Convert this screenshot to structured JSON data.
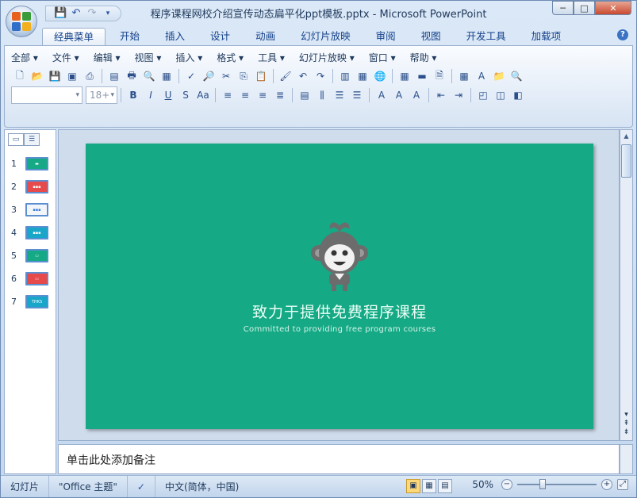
{
  "window": {
    "title": "程序课程网校介绍宣传动态扁平化ppt模板.pptx - Microsoft PowerPoint",
    "controls": {
      "minimize": "─",
      "maximize": "□",
      "close": "✕"
    }
  },
  "qat": {
    "save": "💾",
    "undo": "↶",
    "redo": "↷",
    "more": "▾"
  },
  "tabs": [
    "经典菜单",
    "开始",
    "插入",
    "设计",
    "动画",
    "幻灯片放映",
    "审阅",
    "视图",
    "开发工具",
    "加载项"
  ],
  "menu": [
    "全部 ▾",
    "文件 ▾",
    "编辑 ▾",
    "视图 ▾",
    "插入 ▾",
    "格式 ▾",
    "工具 ▾",
    "幻灯片放映 ▾",
    "窗口 ▾",
    "帮助 ▾"
  ],
  "font": {
    "name": "",
    "size": "18+"
  },
  "toolbar1": [
    "🗋",
    "📂",
    "💾",
    "▣",
    "⎙",
    "▤",
    "🖶",
    "🔍",
    "▦",
    "✓",
    "🔎",
    "✂",
    "⎘",
    "📋",
    "🖌",
    "↶",
    "↷",
    "▥",
    "▦",
    "🌐",
    "▦",
    "▬",
    "🗎",
    "▦",
    "A",
    "📁",
    "🔍"
  ],
  "toolbar2": [
    "B",
    "I",
    "U",
    "S",
    "Aa",
    "≡",
    "≡",
    "≡",
    "≣",
    "▤",
    "⫼",
    "☰",
    "☰",
    "A",
    "A",
    "A",
    "⇤",
    "⇥",
    "◰",
    "◫",
    "◧"
  ],
  "slides": [
    {
      "n": "1",
      "color": "#16a985",
      "label": "▬"
    },
    {
      "n": "2",
      "color": "#e64a4a",
      "label": "▪▪▪"
    },
    {
      "n": "3",
      "color": "#f2f6fb",
      "label": "▪▪▪"
    },
    {
      "n": "4",
      "color": "#18a6c9",
      "label": "▪▪▪"
    },
    {
      "n": "5",
      "color": "#16a985",
      "label": "▭"
    },
    {
      "n": "6",
      "color": "#e64a4a",
      "label": "▭"
    },
    {
      "n": "7",
      "color": "#18a6c9",
      "label": "THKS"
    }
  ],
  "slide": {
    "title": "致力于提供免费程序课程",
    "subtitle": "Committed to providing free  program courses",
    "bg": "#16a985"
  },
  "notes_placeholder": "单击此处添加备注",
  "status": {
    "view": "幻灯片",
    "theme": "\"Office 主题\"",
    "language": "中文(简体，中国)",
    "zoom": "50%"
  }
}
